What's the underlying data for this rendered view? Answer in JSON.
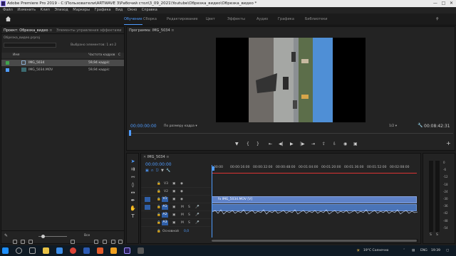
{
  "window": {
    "title": "Adobe Premiere Pro 2019 - C:\\Пользователи\\ARTWAVE 3\\Рабочий стол\\3_09_2021\\Youtube\\Обрезка_видео\\Обрезка_видео *"
  },
  "menu": [
    "Файл",
    "Изменить",
    "Клип",
    "Эпизод",
    "Маркеры",
    "Графика",
    "Вид",
    "Окно",
    "Справка"
  ],
  "workspaces": [
    "Обучение",
    "Сборка",
    "Редактирование",
    "Цвет",
    "Эффекты",
    "Аудио",
    "Графика",
    "Библиотеки"
  ],
  "project": {
    "tab1": "Проект: Обрезка_видео",
    "tab2": "Элементы управления эффектами",
    "file": "Обрезка_видео.prproj",
    "selected_count": "Выбрано элементов: 1 из 2",
    "col_name": "Имя",
    "col_fps": "Частота кадров",
    "col_extra": "С",
    "items": [
      {
        "name": "IMG_5034",
        "fps": "59,94 кадр/с",
        "color": "#3fa34d"
      },
      {
        "name": "IMG_5034.MOV",
        "fps": "59,94 кадр/с",
        "color": "#4f9cff"
      }
    ],
    "footer_label": "Все"
  },
  "program": {
    "title": "Программа: IMG_5034",
    "timecode": "00:00:00:00",
    "fit": "По размеру кадра",
    "resolution": "1/2",
    "duration": "00:08:42:31"
  },
  "timeline": {
    "tab": "IMG_5034",
    "timecode": "00:00:00:00",
    "ruler": [
      "00:00",
      "00:00:16:00",
      "00:00:32:00",
      "00:00:48:00",
      "00:01:04:00",
      "00:01:20:00",
      "00:01:36:00",
      "00:01:52:00",
      "00:02:08:00"
    ],
    "video_tracks": [
      "V3",
      "V2",
      "V1"
    ],
    "audio_tracks": [
      "A1",
      "A2",
      "A3"
    ],
    "mix_label": "Основной",
    "mix_value": "0,0",
    "clip_label": "fx  IMG_5034.MOV [V]",
    "meter_scale": [
      "0",
      "-6",
      "-12",
      "-18",
      "-24",
      "-30",
      "-36",
      "-42",
      "-48",
      "-54"
    ],
    "meter_bottom": [
      "S",
      "S"
    ]
  },
  "taskbar": {
    "weather": "19°C  Солнечно",
    "lang": "ENG",
    "time": "19:39"
  }
}
